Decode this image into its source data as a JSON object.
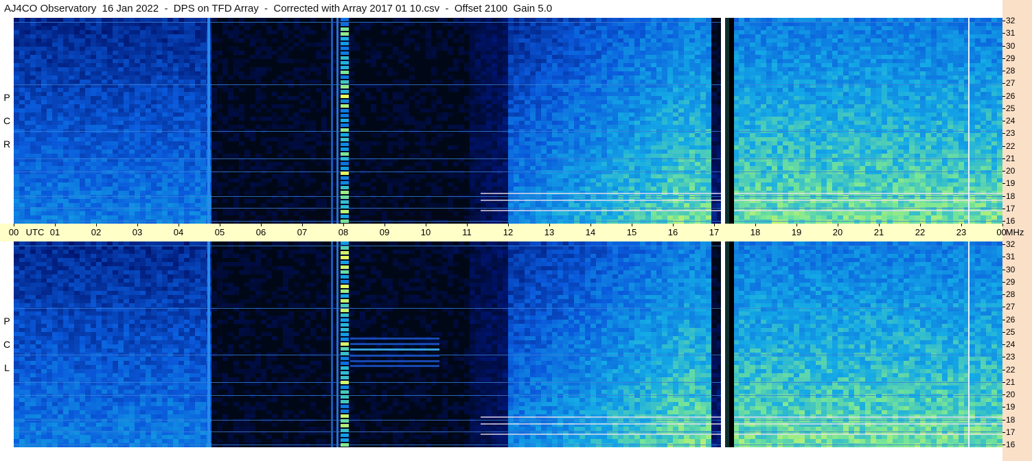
{
  "title": "AJ4CO Observatory  16 Jan 2022  -  DPS on TFD Array  -  Corrected with Array 2017 01 10.csv  -  Offset 2100  Gain 5.0",
  "panels": {
    "top_label": [
      "R",
      "C",
      "P"
    ],
    "bottom_label": [
      "L",
      "C",
      "P"
    ]
  },
  "time_axis": {
    "unit_label": "UTC",
    "hours": [
      "00",
      "01",
      "02",
      "03",
      "04",
      "05",
      "06",
      "07",
      "08",
      "09",
      "10",
      "11",
      "12",
      "13",
      "14",
      "15",
      "16",
      "17",
      "18",
      "19",
      "20",
      "21",
      "22",
      "23",
      "00"
    ]
  },
  "freq_axis": {
    "unit_label": "MHz",
    "values": [
      "32",
      "31",
      "30",
      "29",
      "28",
      "27",
      "26",
      "25",
      "24",
      "23",
      "22",
      "21",
      "20",
      "19",
      "18",
      "17",
      "16"
    ]
  },
  "colors": {
    "background": "#000818",
    "axis_bar": "#ffffc8",
    "right_strip": "#fbe0c8"
  }
}
